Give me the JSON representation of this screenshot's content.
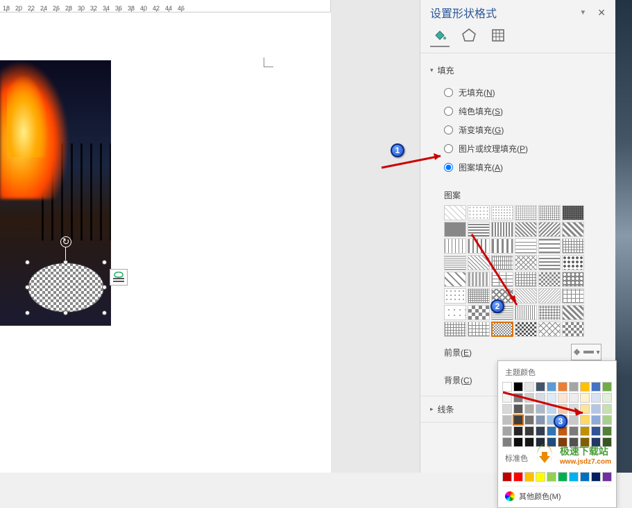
{
  "ruler": {
    "marks": [
      "18",
      "20",
      "22",
      "24",
      "26",
      "28",
      "30",
      "32",
      "34",
      "36",
      "38",
      "40",
      "42",
      "44",
      "46"
    ]
  },
  "panel": {
    "title": "设置形状格式",
    "tabs": {
      "fill_effect": "fill-effect-icon",
      "shape": "pentagon-icon",
      "size": "size-props-icon"
    },
    "sections": {
      "fill": {
        "label": "填充",
        "options": {
          "none": {
            "label": "无填充(",
            "key": "N"
          },
          "solid": {
            "label": "纯色填充(",
            "key": "S"
          },
          "gradient": {
            "label": "渐变填充(",
            "key": "G"
          },
          "picture": {
            "label": "图片或纹理填充(",
            "key": "P"
          },
          "pattern": {
            "label": "图案填充(",
            "key": "A"
          }
        },
        "selected": "pattern",
        "pattern_label": "图案",
        "foreground": {
          "label": "前景(",
          "key": "E"
        },
        "background": {
          "label": "背景(",
          "key": "C"
        }
      },
      "line": {
        "label": "线条"
      }
    }
  },
  "color_popup": {
    "theme_label": "主题颜色",
    "standard_label": "标准色",
    "more_colors": "其他颜色(M)",
    "theme_colors": [
      [
        "#ffffff",
        "#000000",
        "#e7e6e6",
        "#44546a",
        "#5b9bd5",
        "#ed7d31",
        "#a5a5a5",
        "#ffc000",
        "#4472c4",
        "#70ad47"
      ],
      [
        "#f2f2f2",
        "#7f7f7f",
        "#d0cece",
        "#d6dce4",
        "#deebf6",
        "#fbe5d5",
        "#ededed",
        "#fff2cc",
        "#d9e2f3",
        "#e2efd9"
      ],
      [
        "#d8d8d8",
        "#595959",
        "#aeabab",
        "#adb9ca",
        "#bdd7ee",
        "#f7cbac",
        "#dbdbdb",
        "#fee599",
        "#b4c6e7",
        "#c5e0b3"
      ],
      [
        "#bfbfbf",
        "#3f3f3f",
        "#757070",
        "#8496b0",
        "#9cc3e5",
        "#f4b183",
        "#c9c9c9",
        "#ffd965",
        "#8eaadb",
        "#a8d08d"
      ],
      [
        "#a5a5a5",
        "#262626",
        "#3a3838",
        "#323f4f",
        "#2e75b5",
        "#c55a11",
        "#7b7b7b",
        "#bf9000",
        "#2f5496",
        "#538135"
      ],
      [
        "#7f7f7f",
        "#0c0c0c",
        "#171616",
        "#222a35",
        "#1e4e79",
        "#833c0b",
        "#525252",
        "#7f6000",
        "#1f3864",
        "#375623"
      ]
    ],
    "standard_colors": [
      "#c00000",
      "#ff0000",
      "#ffc000",
      "#ffff00",
      "#92d050",
      "#00b050",
      "#00b0f0",
      "#0070c0",
      "#002060",
      "#7030a0"
    ],
    "selected": [
      3,
      1
    ]
  },
  "callouts": {
    "c1": "1",
    "c2": "2",
    "c3": "3"
  },
  "watermark": {
    "name": "极速下载站",
    "url": "www.jsdz7.com"
  }
}
